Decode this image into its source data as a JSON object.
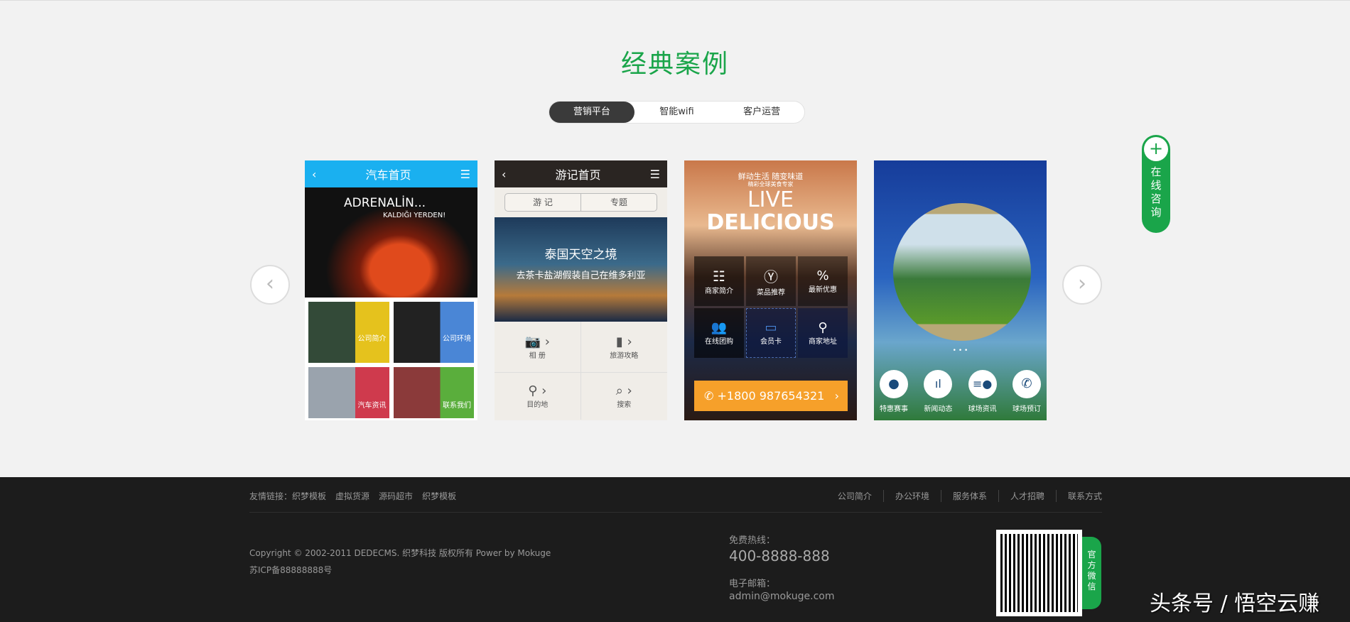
{
  "section_title": "经典案例",
  "tabs": [
    {
      "label": "营销平台",
      "active": true
    },
    {
      "label": "智能wifi"
    },
    {
      "label": "客户运营"
    }
  ],
  "nav": {
    "prev": "‹",
    "next": "›"
  },
  "cards": {
    "car": {
      "title": "汽车首页",
      "banner_line1": "ADRENALİN...",
      "banner_line2": "KALDIĞI YERDEN!",
      "tiles": [
        "公司简介",
        "公司环境",
        "汽车资讯",
        "联系我们"
      ],
      "accent": "#1ab0f0"
    },
    "travel": {
      "title": "游记首页",
      "tabs": [
        "游 记",
        "专题"
      ],
      "banner_title": "泰国天空之境",
      "banner_sub": "去茶卡盐湖假装自己在维多利亚",
      "items": [
        "相 册",
        "旅游攻略",
        "目的地",
        "搜索"
      ]
    },
    "food": {
      "slogan": "鲜动生活 随变味道",
      "sub": "精彩全球美食专家",
      "live": "LIVE",
      "delicious": "DELICIOUS",
      "items": [
        "商家简介",
        "菜品推荐",
        "最新优惠",
        "在线团购",
        "会员卡",
        "商家地址"
      ],
      "phone": "+1800 987654321"
    },
    "golf": {
      "dots": "• • •",
      "items": [
        "特惠赛事",
        "新闻动态",
        "球场资讯",
        "球场预订"
      ]
    }
  },
  "consult": {
    "label": "在线咨询"
  },
  "footer": {
    "friend_label": "友情链接：",
    "friend_links": [
      "织梦模板",
      "虚拟货源",
      "源码超市",
      "织梦模板"
    ],
    "right_links": [
      "公司简介",
      "办公环境",
      "服务体系",
      "人才招聘",
      "联系方式"
    ],
    "copyright": "Copyright © 2002-2011 DEDECMS. 织梦科技 版权所有 Power by Mokuge",
    "icp": "苏ICP备88888888号",
    "hotline_label": "免费热线：",
    "hotline": "400-8888-888",
    "email_label": "电子邮箱：",
    "email": "admin@mokuge.com",
    "wechat_label": "官方微信"
  },
  "watermark": "头条号 / 悟空云赚"
}
